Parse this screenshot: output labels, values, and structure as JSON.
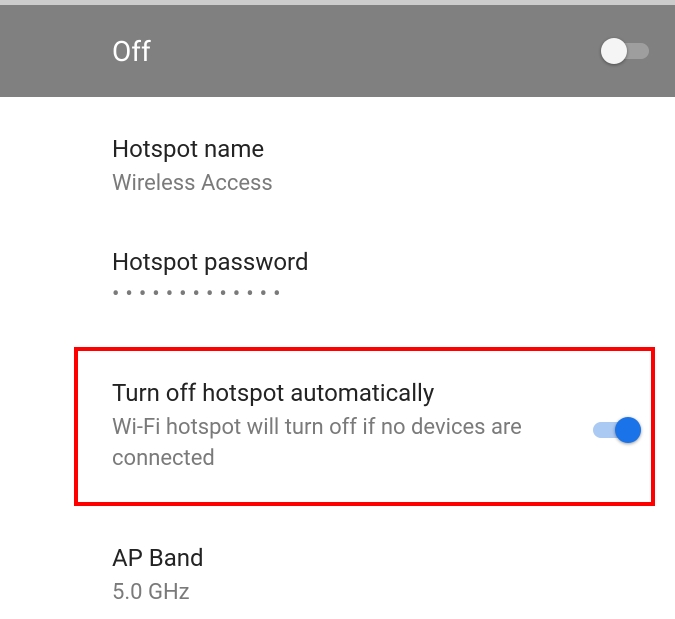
{
  "header": {
    "title": "Off",
    "toggle_state": "off"
  },
  "settings": {
    "hotspot_name": {
      "label": "Hotspot name",
      "value": "Wireless Access"
    },
    "hotspot_password": {
      "label": "Hotspot password",
      "masked_value": "•••••••••••••"
    },
    "auto_off": {
      "label": "Turn off hotspot automatically",
      "description": "Wi-Fi hotspot will turn off if no devices are connected",
      "toggle_state": "on"
    },
    "ap_band": {
      "label": "AP Band",
      "value": "5.0 GHz"
    }
  }
}
